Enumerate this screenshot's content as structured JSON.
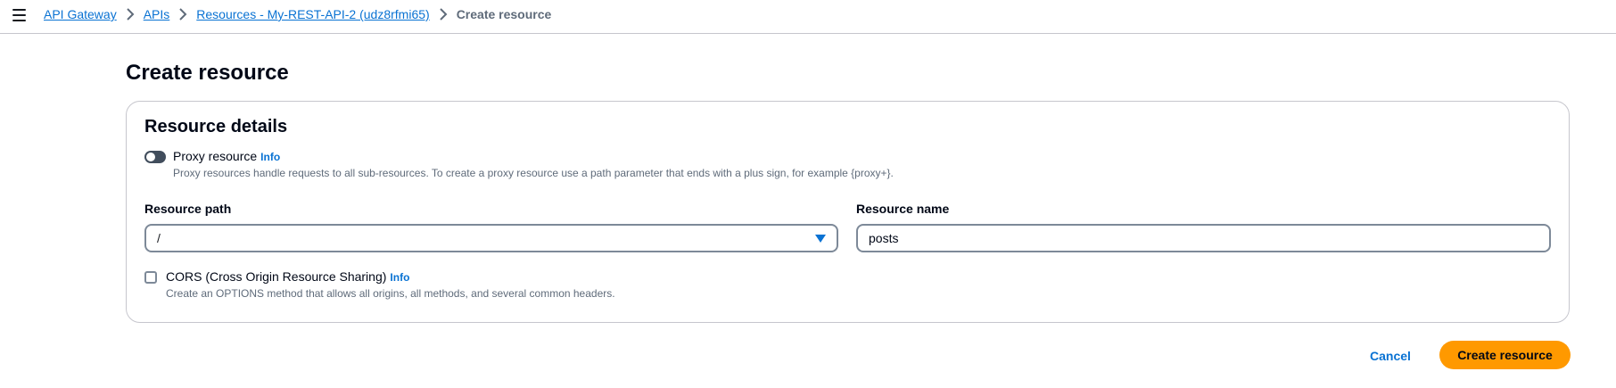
{
  "breadcrumb": {
    "items": [
      {
        "label": "API Gateway"
      },
      {
        "label": "APIs"
      },
      {
        "label": "Resources - My-REST-API-2 (udz8rfmi65)"
      }
    ],
    "current": "Create resource"
  },
  "page": {
    "title": "Create resource"
  },
  "resource_details": {
    "title": "Resource details",
    "proxy": {
      "label": "Proxy resource",
      "info": "Info",
      "description": "Proxy resources handle requests to all sub-resources. To create a proxy resource use a path parameter that ends with a plus sign, for example {proxy+}.",
      "enabled": false
    },
    "resource_path": {
      "label": "Resource path",
      "value": "/"
    },
    "resource_name": {
      "label": "Resource name",
      "value": "posts"
    },
    "cors": {
      "label": "CORS (Cross Origin Resource Sharing)",
      "info": "Info",
      "description": "Create an OPTIONS method that allows all origins, all methods, and several common headers.",
      "checked": false
    }
  },
  "actions": {
    "cancel": "Cancel",
    "create": "Create resource"
  },
  "colors": {
    "link": "#0972d3",
    "primary_button": "#ff9900",
    "toggle_off": "#414d5c"
  }
}
